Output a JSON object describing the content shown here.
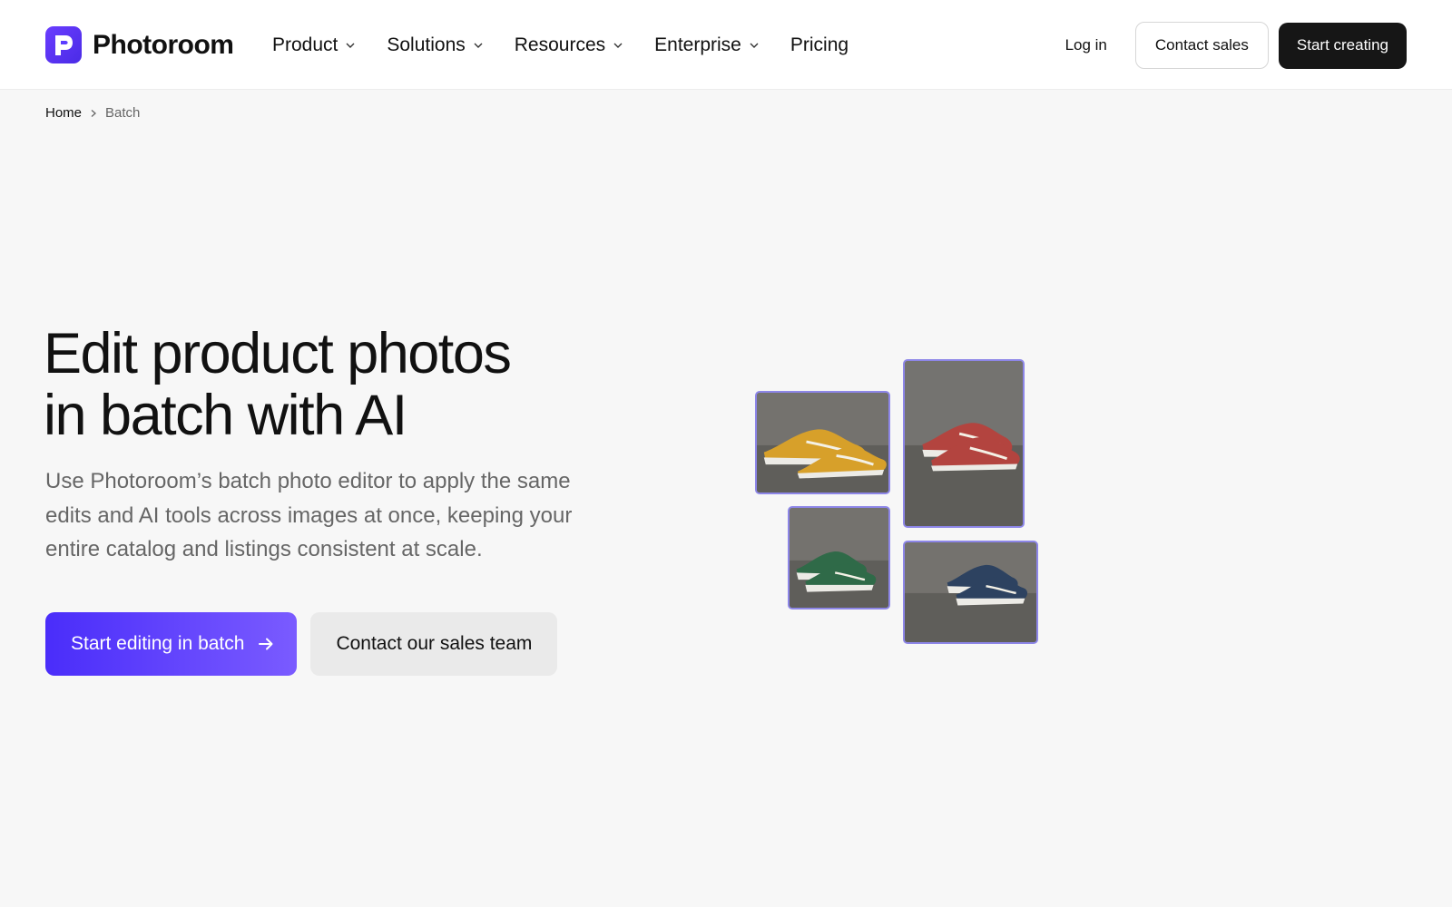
{
  "brand": {
    "name": "Photoroom",
    "accent": "#5b3cff"
  },
  "nav": {
    "items": [
      {
        "label": "Product",
        "has_dropdown": true
      },
      {
        "label": "Solutions",
        "has_dropdown": true
      },
      {
        "label": "Resources",
        "has_dropdown": true
      },
      {
        "label": "Enterprise",
        "has_dropdown": true
      },
      {
        "label": "Pricing",
        "has_dropdown": false
      }
    ]
  },
  "header_actions": {
    "login_label": "Log in",
    "contact_label": "Contact sales",
    "start_label": "Start creating"
  },
  "breadcrumb": {
    "home": "Home",
    "current": "Batch"
  },
  "hero": {
    "title_line1": "Edit product photos",
    "title_line2": "in batch with AI",
    "subtitle": "Use Photoroom’s batch photo editor to apply the same edits and AI tools across images at once, keeping your entire catalog and listings consistent at scale.",
    "primary_cta": "Start editing in batch",
    "secondary_cta": "Contact our sales team"
  },
  "gallery": {
    "images": [
      {
        "name": "yellow-sneaker",
        "color": "#d7a02a"
      },
      {
        "name": "red-sneaker",
        "color": "#b3443f"
      },
      {
        "name": "green-sneaker",
        "color": "#2f6a48"
      },
      {
        "name": "navy-sneaker",
        "color": "#2d4260"
      }
    ]
  }
}
